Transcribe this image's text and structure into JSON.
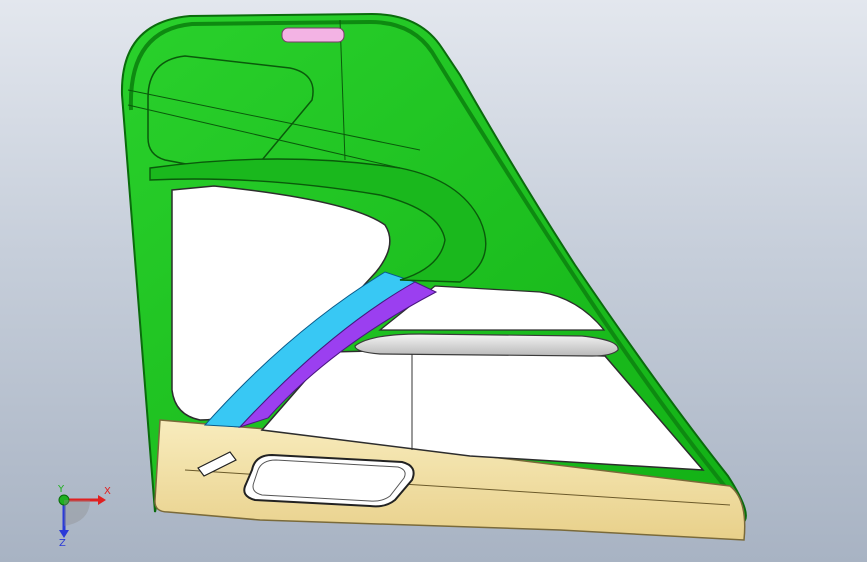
{
  "viewport": {
    "background_top": "#e3e7ee",
    "background_bottom": "#a8b3c3"
  },
  "model": {
    "colors": {
      "frame": "#17c11a",
      "frame_edge": "#0b7a0e",
      "lower_trim": "#f3e2a6",
      "blue_strip": "#38c8f4",
      "purple_strip": "#9b3ff0",
      "clip": "#f3b3e4",
      "panel": "#ffffff"
    }
  },
  "triad": {
    "x_label": "X",
    "y_label": "Y",
    "z_label": "Z",
    "x_color": "#e02020",
    "y_color": "#20b020",
    "z_color": "#2a3ad8"
  }
}
